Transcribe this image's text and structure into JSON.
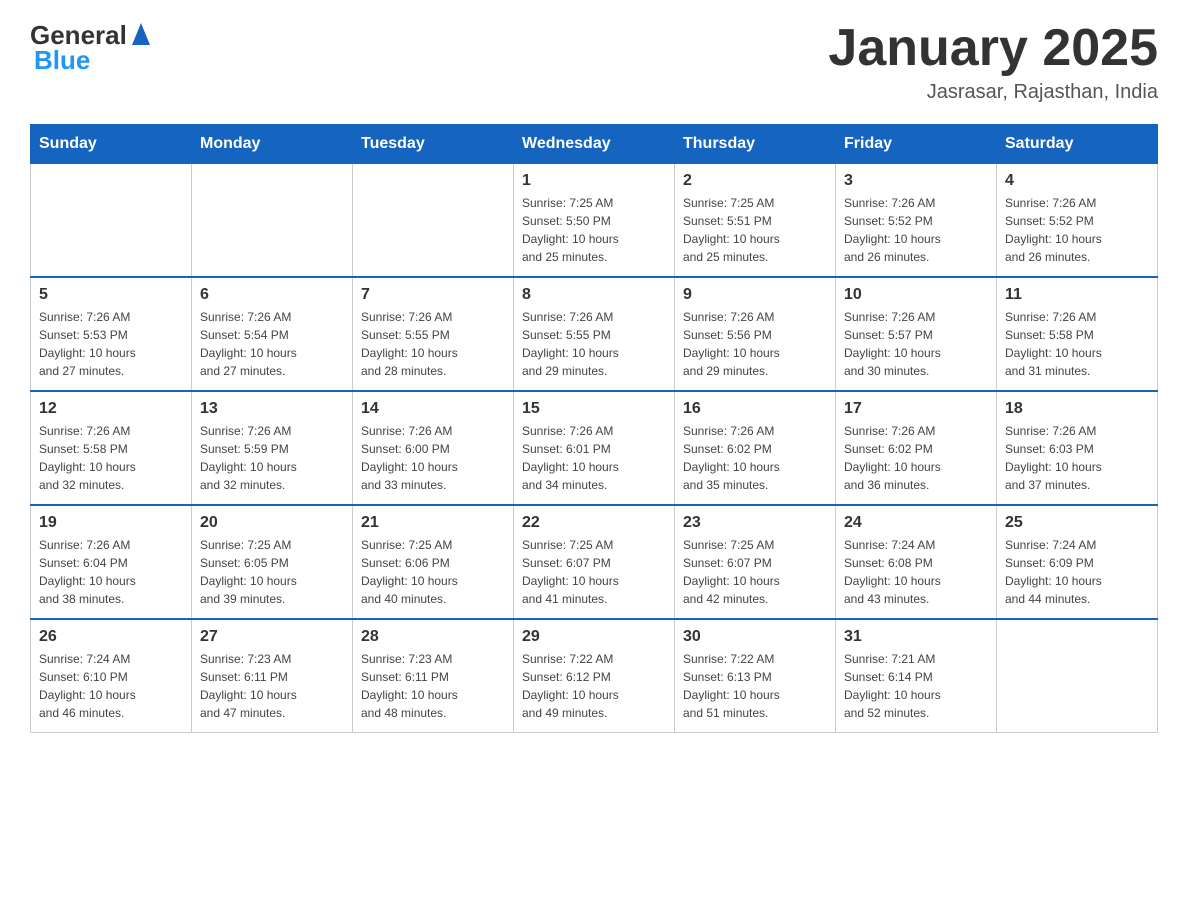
{
  "header": {
    "logo": {
      "text_general": "General",
      "text_blue": "Blue"
    },
    "title": "January 2025",
    "location": "Jasrasar, Rajasthan, India"
  },
  "days_of_week": [
    "Sunday",
    "Monday",
    "Tuesday",
    "Wednesday",
    "Thursday",
    "Friday",
    "Saturday"
  ],
  "weeks": [
    [
      {
        "day": "",
        "info": ""
      },
      {
        "day": "",
        "info": ""
      },
      {
        "day": "",
        "info": ""
      },
      {
        "day": "1",
        "info": "Sunrise: 7:25 AM\nSunset: 5:50 PM\nDaylight: 10 hours\nand 25 minutes."
      },
      {
        "day": "2",
        "info": "Sunrise: 7:25 AM\nSunset: 5:51 PM\nDaylight: 10 hours\nand 25 minutes."
      },
      {
        "day": "3",
        "info": "Sunrise: 7:26 AM\nSunset: 5:52 PM\nDaylight: 10 hours\nand 26 minutes."
      },
      {
        "day": "4",
        "info": "Sunrise: 7:26 AM\nSunset: 5:52 PM\nDaylight: 10 hours\nand 26 minutes."
      }
    ],
    [
      {
        "day": "5",
        "info": "Sunrise: 7:26 AM\nSunset: 5:53 PM\nDaylight: 10 hours\nand 27 minutes."
      },
      {
        "day": "6",
        "info": "Sunrise: 7:26 AM\nSunset: 5:54 PM\nDaylight: 10 hours\nand 27 minutes."
      },
      {
        "day": "7",
        "info": "Sunrise: 7:26 AM\nSunset: 5:55 PM\nDaylight: 10 hours\nand 28 minutes."
      },
      {
        "day": "8",
        "info": "Sunrise: 7:26 AM\nSunset: 5:55 PM\nDaylight: 10 hours\nand 29 minutes."
      },
      {
        "day": "9",
        "info": "Sunrise: 7:26 AM\nSunset: 5:56 PM\nDaylight: 10 hours\nand 29 minutes."
      },
      {
        "day": "10",
        "info": "Sunrise: 7:26 AM\nSunset: 5:57 PM\nDaylight: 10 hours\nand 30 minutes."
      },
      {
        "day": "11",
        "info": "Sunrise: 7:26 AM\nSunset: 5:58 PM\nDaylight: 10 hours\nand 31 minutes."
      }
    ],
    [
      {
        "day": "12",
        "info": "Sunrise: 7:26 AM\nSunset: 5:58 PM\nDaylight: 10 hours\nand 32 minutes."
      },
      {
        "day": "13",
        "info": "Sunrise: 7:26 AM\nSunset: 5:59 PM\nDaylight: 10 hours\nand 32 minutes."
      },
      {
        "day": "14",
        "info": "Sunrise: 7:26 AM\nSunset: 6:00 PM\nDaylight: 10 hours\nand 33 minutes."
      },
      {
        "day": "15",
        "info": "Sunrise: 7:26 AM\nSunset: 6:01 PM\nDaylight: 10 hours\nand 34 minutes."
      },
      {
        "day": "16",
        "info": "Sunrise: 7:26 AM\nSunset: 6:02 PM\nDaylight: 10 hours\nand 35 minutes."
      },
      {
        "day": "17",
        "info": "Sunrise: 7:26 AM\nSunset: 6:02 PM\nDaylight: 10 hours\nand 36 minutes."
      },
      {
        "day": "18",
        "info": "Sunrise: 7:26 AM\nSunset: 6:03 PM\nDaylight: 10 hours\nand 37 minutes."
      }
    ],
    [
      {
        "day": "19",
        "info": "Sunrise: 7:26 AM\nSunset: 6:04 PM\nDaylight: 10 hours\nand 38 minutes."
      },
      {
        "day": "20",
        "info": "Sunrise: 7:25 AM\nSunset: 6:05 PM\nDaylight: 10 hours\nand 39 minutes."
      },
      {
        "day": "21",
        "info": "Sunrise: 7:25 AM\nSunset: 6:06 PM\nDaylight: 10 hours\nand 40 minutes."
      },
      {
        "day": "22",
        "info": "Sunrise: 7:25 AM\nSunset: 6:07 PM\nDaylight: 10 hours\nand 41 minutes."
      },
      {
        "day": "23",
        "info": "Sunrise: 7:25 AM\nSunset: 6:07 PM\nDaylight: 10 hours\nand 42 minutes."
      },
      {
        "day": "24",
        "info": "Sunrise: 7:24 AM\nSunset: 6:08 PM\nDaylight: 10 hours\nand 43 minutes."
      },
      {
        "day": "25",
        "info": "Sunrise: 7:24 AM\nSunset: 6:09 PM\nDaylight: 10 hours\nand 44 minutes."
      }
    ],
    [
      {
        "day": "26",
        "info": "Sunrise: 7:24 AM\nSunset: 6:10 PM\nDaylight: 10 hours\nand 46 minutes."
      },
      {
        "day": "27",
        "info": "Sunrise: 7:23 AM\nSunset: 6:11 PM\nDaylight: 10 hours\nand 47 minutes."
      },
      {
        "day": "28",
        "info": "Sunrise: 7:23 AM\nSunset: 6:11 PM\nDaylight: 10 hours\nand 48 minutes."
      },
      {
        "day": "29",
        "info": "Sunrise: 7:22 AM\nSunset: 6:12 PM\nDaylight: 10 hours\nand 49 minutes."
      },
      {
        "day": "30",
        "info": "Sunrise: 7:22 AM\nSunset: 6:13 PM\nDaylight: 10 hours\nand 51 minutes."
      },
      {
        "day": "31",
        "info": "Sunrise: 7:21 AM\nSunset: 6:14 PM\nDaylight: 10 hours\nand 52 minutes."
      },
      {
        "day": "",
        "info": ""
      }
    ]
  ]
}
